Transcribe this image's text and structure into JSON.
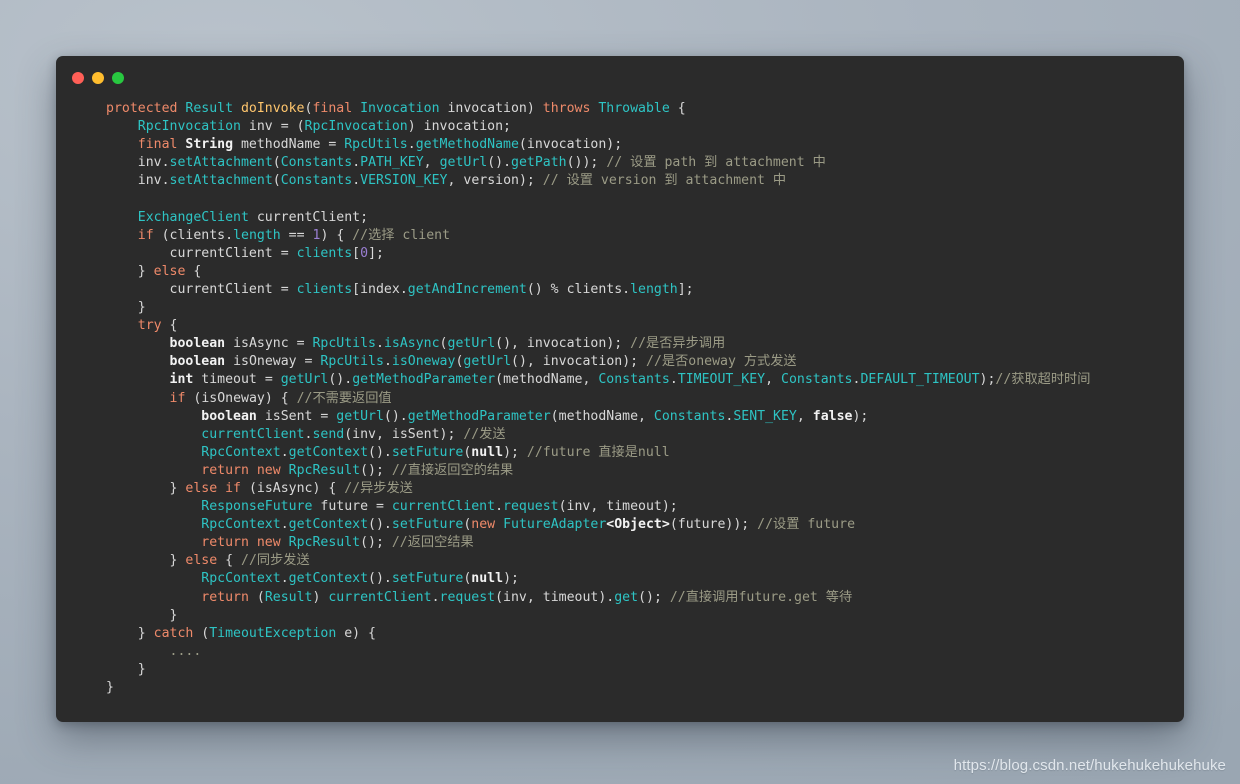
{
  "window": {
    "title": "",
    "traffic_lights": [
      {
        "name": "close-button",
        "color": "#ff5f57"
      },
      {
        "name": "minimize-button",
        "color": "#ffbd2e"
      },
      {
        "name": "zoom-button",
        "color": "#28c840"
      }
    ]
  },
  "watermark": {
    "text": "https://blog.csdn.net/hukehukehukehuke"
  },
  "code": {
    "language": "java",
    "theme": {
      "background": "#2b2b2b",
      "foreground": "#d8d8d8",
      "keyword": "#ef8a6a",
      "type": "#2ec4c4",
      "function": "#ffc66d",
      "number": "#9b7fd4",
      "comment": "#9b9b86",
      "primitive": "#f2f2f2"
    },
    "lines": [
      [
        {
          "t": "kw",
          "s": "protected "
        },
        {
          "t": "typ",
          "s": "Result "
        },
        {
          "t": "fn",
          "s": "doInvoke"
        },
        {
          "t": "pun",
          "s": "("
        },
        {
          "t": "kw",
          "s": "final "
        },
        {
          "t": "typ",
          "s": "Invocation "
        },
        {
          "t": "var",
          "s": "invocation"
        },
        {
          "t": "pun",
          "s": ") "
        },
        {
          "t": "kw",
          "s": "throws "
        },
        {
          "t": "typ",
          "s": "Throwable "
        },
        {
          "t": "pun",
          "s": "{"
        }
      ],
      [
        {
          "t": "pun",
          "s": "    "
        },
        {
          "t": "typ",
          "s": "RpcInvocation "
        },
        {
          "t": "var",
          "s": "inv "
        },
        {
          "t": "pun",
          "s": "= ("
        },
        {
          "t": "typ",
          "s": "RpcInvocation"
        },
        {
          "t": "pun",
          "s": ") "
        },
        {
          "t": "var",
          "s": "invocation"
        },
        {
          "t": "pun",
          "s": ";"
        }
      ],
      [
        {
          "t": "pun",
          "s": "    "
        },
        {
          "t": "kw",
          "s": "final "
        },
        {
          "t": "prim",
          "s": "String "
        },
        {
          "t": "var",
          "s": "methodName "
        },
        {
          "t": "pun",
          "s": "= "
        },
        {
          "t": "typ",
          "s": "RpcUtils"
        },
        {
          "t": "pun",
          "s": "."
        },
        {
          "t": "mem",
          "s": "getMethodName"
        },
        {
          "t": "pun",
          "s": "("
        },
        {
          "t": "var",
          "s": "invocation"
        },
        {
          "t": "pun",
          "s": ");"
        }
      ],
      [
        {
          "t": "pun",
          "s": "    "
        },
        {
          "t": "var",
          "s": "inv"
        },
        {
          "t": "pun",
          "s": "."
        },
        {
          "t": "mem",
          "s": "setAttachment"
        },
        {
          "t": "pun",
          "s": "("
        },
        {
          "t": "typ",
          "s": "Constants"
        },
        {
          "t": "pun",
          "s": "."
        },
        {
          "t": "mem",
          "s": "PATH_KEY"
        },
        {
          "t": "pun",
          "s": ", "
        },
        {
          "t": "mem",
          "s": "getUrl"
        },
        {
          "t": "pun",
          "s": "()."
        },
        {
          "t": "mem",
          "s": "getPath"
        },
        {
          "t": "pun",
          "s": "()); "
        },
        {
          "t": "cmt",
          "s": "// 设置 path 到 attachment 中"
        }
      ],
      [
        {
          "t": "pun",
          "s": "    "
        },
        {
          "t": "var",
          "s": "inv"
        },
        {
          "t": "pun",
          "s": "."
        },
        {
          "t": "mem",
          "s": "setAttachment"
        },
        {
          "t": "pun",
          "s": "("
        },
        {
          "t": "typ",
          "s": "Constants"
        },
        {
          "t": "pun",
          "s": "."
        },
        {
          "t": "mem",
          "s": "VERSION_KEY"
        },
        {
          "t": "pun",
          "s": ", "
        },
        {
          "t": "var",
          "s": "version"
        },
        {
          "t": "pun",
          "s": "); "
        },
        {
          "t": "cmt",
          "s": "// 设置 version 到 attachment 中"
        }
      ],
      [],
      [
        {
          "t": "pun",
          "s": "    "
        },
        {
          "t": "typ",
          "s": "ExchangeClient "
        },
        {
          "t": "var",
          "s": "currentClient"
        },
        {
          "t": "pun",
          "s": ";"
        }
      ],
      [
        {
          "t": "pun",
          "s": "    "
        },
        {
          "t": "kw",
          "s": "if "
        },
        {
          "t": "pun",
          "s": "("
        },
        {
          "t": "var",
          "s": "clients"
        },
        {
          "t": "pun",
          "s": "."
        },
        {
          "t": "mem",
          "s": "length "
        },
        {
          "t": "pun",
          "s": "== "
        },
        {
          "t": "num",
          "s": "1"
        },
        {
          "t": "pun",
          "s": ") { "
        },
        {
          "t": "cmt",
          "s": "//选择 client"
        }
      ],
      [
        {
          "t": "pun",
          "s": "        "
        },
        {
          "t": "var",
          "s": "currentClient "
        },
        {
          "t": "pun",
          "s": "= "
        },
        {
          "t": "mem",
          "s": "clients"
        },
        {
          "t": "pun",
          "s": "["
        },
        {
          "t": "num",
          "s": "0"
        },
        {
          "t": "pun",
          "s": "];"
        }
      ],
      [
        {
          "t": "pun",
          "s": "    } "
        },
        {
          "t": "kw",
          "s": "else "
        },
        {
          "t": "pun",
          "s": "{"
        }
      ],
      [
        {
          "t": "pun",
          "s": "        "
        },
        {
          "t": "var",
          "s": "currentClient "
        },
        {
          "t": "pun",
          "s": "= "
        },
        {
          "t": "mem",
          "s": "clients"
        },
        {
          "t": "pun",
          "s": "["
        },
        {
          "t": "var",
          "s": "index"
        },
        {
          "t": "pun",
          "s": "."
        },
        {
          "t": "mem",
          "s": "getAndIncrement"
        },
        {
          "t": "pun",
          "s": "() % "
        },
        {
          "t": "var",
          "s": "clients"
        },
        {
          "t": "pun",
          "s": "."
        },
        {
          "t": "mem",
          "s": "length"
        },
        {
          "t": "pun",
          "s": "];"
        }
      ],
      [
        {
          "t": "pun",
          "s": "    }"
        }
      ],
      [
        {
          "t": "pun",
          "s": "    "
        },
        {
          "t": "kw",
          "s": "try "
        },
        {
          "t": "pun",
          "s": "{"
        }
      ],
      [
        {
          "t": "pun",
          "s": "        "
        },
        {
          "t": "prim",
          "s": "boolean "
        },
        {
          "t": "var",
          "s": "isAsync "
        },
        {
          "t": "pun",
          "s": "= "
        },
        {
          "t": "typ",
          "s": "RpcUtils"
        },
        {
          "t": "pun",
          "s": "."
        },
        {
          "t": "mem",
          "s": "isAsync"
        },
        {
          "t": "pun",
          "s": "("
        },
        {
          "t": "mem",
          "s": "getUrl"
        },
        {
          "t": "pun",
          "s": "(), "
        },
        {
          "t": "var",
          "s": "invocation"
        },
        {
          "t": "pun",
          "s": "); "
        },
        {
          "t": "cmt",
          "s": "//是否异步调用"
        }
      ],
      [
        {
          "t": "pun",
          "s": "        "
        },
        {
          "t": "prim",
          "s": "boolean "
        },
        {
          "t": "var",
          "s": "isOneway "
        },
        {
          "t": "pun",
          "s": "= "
        },
        {
          "t": "typ",
          "s": "RpcUtils"
        },
        {
          "t": "pun",
          "s": "."
        },
        {
          "t": "mem",
          "s": "isOneway"
        },
        {
          "t": "pun",
          "s": "("
        },
        {
          "t": "mem",
          "s": "getUrl"
        },
        {
          "t": "pun",
          "s": "(), "
        },
        {
          "t": "var",
          "s": "invocation"
        },
        {
          "t": "pun",
          "s": "); "
        },
        {
          "t": "cmt",
          "s": "//是否oneway 方式发送"
        }
      ],
      [
        {
          "t": "pun",
          "s": "        "
        },
        {
          "t": "prim",
          "s": "int "
        },
        {
          "t": "var",
          "s": "timeout "
        },
        {
          "t": "pun",
          "s": "= "
        },
        {
          "t": "mem",
          "s": "getUrl"
        },
        {
          "t": "pun",
          "s": "()."
        },
        {
          "t": "mem",
          "s": "getMethodParameter"
        },
        {
          "t": "pun",
          "s": "("
        },
        {
          "t": "var",
          "s": "methodName"
        },
        {
          "t": "pun",
          "s": ", "
        },
        {
          "t": "typ",
          "s": "Constants"
        },
        {
          "t": "pun",
          "s": "."
        },
        {
          "t": "mem",
          "s": "TIMEOUT_KEY"
        },
        {
          "t": "pun",
          "s": ", "
        },
        {
          "t": "typ",
          "s": "Constants"
        },
        {
          "t": "pun",
          "s": "."
        },
        {
          "t": "mem",
          "s": "DEFAULT_TIMEOUT"
        },
        {
          "t": "pun",
          "s": ");"
        },
        {
          "t": "cmt",
          "s": "//获取超时时间"
        }
      ],
      [
        {
          "t": "pun",
          "s": "        "
        },
        {
          "t": "kw",
          "s": "if "
        },
        {
          "t": "pun",
          "s": "("
        },
        {
          "t": "var",
          "s": "isOneway"
        },
        {
          "t": "pun",
          "s": ") { "
        },
        {
          "t": "cmt",
          "s": "//不需要返回值"
        }
      ],
      [
        {
          "t": "pun",
          "s": "            "
        },
        {
          "t": "prim",
          "s": "boolean "
        },
        {
          "t": "var",
          "s": "isSent "
        },
        {
          "t": "pun",
          "s": "= "
        },
        {
          "t": "mem",
          "s": "getUrl"
        },
        {
          "t": "pun",
          "s": "()."
        },
        {
          "t": "mem",
          "s": "getMethodParameter"
        },
        {
          "t": "pun",
          "s": "("
        },
        {
          "t": "var",
          "s": "methodName"
        },
        {
          "t": "pun",
          "s": ", "
        },
        {
          "t": "typ",
          "s": "Constants"
        },
        {
          "t": "pun",
          "s": "."
        },
        {
          "t": "mem",
          "s": "SENT_KEY"
        },
        {
          "t": "pun",
          "s": ", "
        },
        {
          "t": "prim",
          "s": "false"
        },
        {
          "t": "pun",
          "s": ");"
        }
      ],
      [
        {
          "t": "pun",
          "s": "            "
        },
        {
          "t": "mem",
          "s": "currentClient"
        },
        {
          "t": "pun",
          "s": "."
        },
        {
          "t": "mem",
          "s": "send"
        },
        {
          "t": "pun",
          "s": "("
        },
        {
          "t": "var",
          "s": "inv"
        },
        {
          "t": "pun",
          "s": ", "
        },
        {
          "t": "var",
          "s": "isSent"
        },
        {
          "t": "pun",
          "s": "); "
        },
        {
          "t": "cmt",
          "s": "//发送"
        }
      ],
      [
        {
          "t": "pun",
          "s": "            "
        },
        {
          "t": "typ",
          "s": "RpcContext"
        },
        {
          "t": "pun",
          "s": "."
        },
        {
          "t": "mem",
          "s": "getContext"
        },
        {
          "t": "pun",
          "s": "()."
        },
        {
          "t": "mem",
          "s": "setFuture"
        },
        {
          "t": "pun",
          "s": "("
        },
        {
          "t": "prim",
          "s": "null"
        },
        {
          "t": "pun",
          "s": "); "
        },
        {
          "t": "cmt",
          "s": "//future 直接是null"
        }
      ],
      [
        {
          "t": "pun",
          "s": "            "
        },
        {
          "t": "kw",
          "s": "return new "
        },
        {
          "t": "typ",
          "s": "RpcResult"
        },
        {
          "t": "pun",
          "s": "(); "
        },
        {
          "t": "cmt",
          "s": "//直接返回空的结果"
        }
      ],
      [
        {
          "t": "pun",
          "s": "        } "
        },
        {
          "t": "kw",
          "s": "else if "
        },
        {
          "t": "pun",
          "s": "("
        },
        {
          "t": "var",
          "s": "isAsync"
        },
        {
          "t": "pun",
          "s": ") { "
        },
        {
          "t": "cmt",
          "s": "//异步发送"
        }
      ],
      [
        {
          "t": "pun",
          "s": "            "
        },
        {
          "t": "typ",
          "s": "ResponseFuture "
        },
        {
          "t": "var",
          "s": "future "
        },
        {
          "t": "pun",
          "s": "= "
        },
        {
          "t": "mem",
          "s": "currentClient"
        },
        {
          "t": "pun",
          "s": "."
        },
        {
          "t": "mem",
          "s": "request"
        },
        {
          "t": "pun",
          "s": "("
        },
        {
          "t": "var",
          "s": "inv"
        },
        {
          "t": "pun",
          "s": ", "
        },
        {
          "t": "var",
          "s": "timeout"
        },
        {
          "t": "pun",
          "s": ");"
        }
      ],
      [
        {
          "t": "pun",
          "s": "            "
        },
        {
          "t": "typ",
          "s": "RpcContext"
        },
        {
          "t": "pun",
          "s": "."
        },
        {
          "t": "mem",
          "s": "getContext"
        },
        {
          "t": "pun",
          "s": "()."
        },
        {
          "t": "mem",
          "s": "setFuture"
        },
        {
          "t": "pun",
          "s": "("
        },
        {
          "t": "kw",
          "s": "new "
        },
        {
          "t": "typ",
          "s": "FutureAdapter"
        },
        {
          "t": "prim",
          "s": "<Object>"
        },
        {
          "t": "pun",
          "s": "("
        },
        {
          "t": "var",
          "s": "future"
        },
        {
          "t": "pun",
          "s": ")); "
        },
        {
          "t": "cmt",
          "s": "//设置 future"
        }
      ],
      [
        {
          "t": "pun",
          "s": "            "
        },
        {
          "t": "kw",
          "s": "return new "
        },
        {
          "t": "typ",
          "s": "RpcResult"
        },
        {
          "t": "pun",
          "s": "(); "
        },
        {
          "t": "cmt",
          "s": "//返回空结果"
        }
      ],
      [
        {
          "t": "pun",
          "s": "        } "
        },
        {
          "t": "kw",
          "s": "else "
        },
        {
          "t": "pun",
          "s": "{ "
        },
        {
          "t": "cmt",
          "s": "//同步发送"
        }
      ],
      [
        {
          "t": "pun",
          "s": "            "
        },
        {
          "t": "typ",
          "s": "RpcContext"
        },
        {
          "t": "pun",
          "s": "."
        },
        {
          "t": "mem",
          "s": "getContext"
        },
        {
          "t": "pun",
          "s": "()."
        },
        {
          "t": "mem",
          "s": "setFuture"
        },
        {
          "t": "pun",
          "s": "("
        },
        {
          "t": "prim",
          "s": "null"
        },
        {
          "t": "pun",
          "s": ");"
        }
      ],
      [
        {
          "t": "pun",
          "s": "            "
        },
        {
          "t": "kw",
          "s": "return "
        },
        {
          "t": "pun",
          "s": "("
        },
        {
          "t": "typ",
          "s": "Result"
        },
        {
          "t": "pun",
          "s": ") "
        },
        {
          "t": "mem",
          "s": "currentClient"
        },
        {
          "t": "pun",
          "s": "."
        },
        {
          "t": "mem",
          "s": "request"
        },
        {
          "t": "pun",
          "s": "("
        },
        {
          "t": "var",
          "s": "inv"
        },
        {
          "t": "pun",
          "s": ", "
        },
        {
          "t": "var",
          "s": "timeout"
        },
        {
          "t": "pun",
          "s": ")."
        },
        {
          "t": "mem",
          "s": "get"
        },
        {
          "t": "pun",
          "s": "(); "
        },
        {
          "t": "cmt",
          "s": "//直接调用future.get 等待"
        }
      ],
      [
        {
          "t": "pun",
          "s": "        }"
        }
      ],
      [
        {
          "t": "pun",
          "s": "    } "
        },
        {
          "t": "kw",
          "s": "catch "
        },
        {
          "t": "pun",
          "s": "("
        },
        {
          "t": "typ",
          "s": "TimeoutException "
        },
        {
          "t": "var",
          "s": "e"
        },
        {
          "t": "pun",
          "s": ") {"
        }
      ],
      [
        {
          "t": "pun",
          "s": "        "
        },
        {
          "t": "cmt",
          "s": "...."
        }
      ],
      [
        {
          "t": "pun",
          "s": "    }"
        }
      ],
      [
        {
          "t": "pun",
          "s": "}"
        }
      ]
    ]
  }
}
